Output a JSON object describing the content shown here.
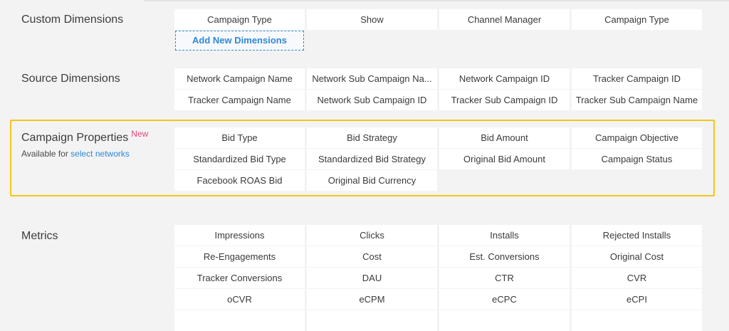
{
  "custom_dimensions": {
    "title": "Custom Dimensions",
    "items": [
      "Campaign Type",
      "Show",
      "Channel Manager",
      "Campaign Type"
    ],
    "add_label": "Add New Dimensions"
  },
  "source_dimensions": {
    "title": "Source Dimensions",
    "items": [
      "Network Campaign Name",
      "Network Sub Campaign Na...",
      "Network Campaign ID",
      "Tracker Campaign ID",
      "Tracker Campaign Name",
      "Network Sub Campaign ID",
      "Tracker Sub Campaign ID",
      "Tracker Sub Campaign Name"
    ]
  },
  "campaign_properties": {
    "title": "Campaign Properties",
    "badge": "New",
    "subtitle_prefix": "Available for",
    "subtitle_link": "select networks",
    "items": [
      "Bid Type",
      "Bid Strategy",
      "Bid Amount",
      "Campaign Objective",
      "Standardized Bid Type",
      "Standardized Bid Strategy",
      "Original Bid Amount",
      "Campaign Status",
      "Facebook ROAS Bid",
      "Original Bid Currency"
    ]
  },
  "metrics": {
    "title": "Metrics",
    "items": [
      "Impressions",
      "Clicks",
      "Installs",
      "Rejected Installs",
      "Re-Engagements",
      "Cost",
      "Est. Conversions",
      "Original Cost",
      "Tracker Conversions",
      "DAU",
      "CTR",
      "CVR",
      "oCVR",
      "eCPM",
      "eCPC",
      "eCPI"
    ]
  },
  "colors": {
    "accent": "#2f88d8",
    "highlight": "#f5c518",
    "badge": "#e6467e"
  }
}
